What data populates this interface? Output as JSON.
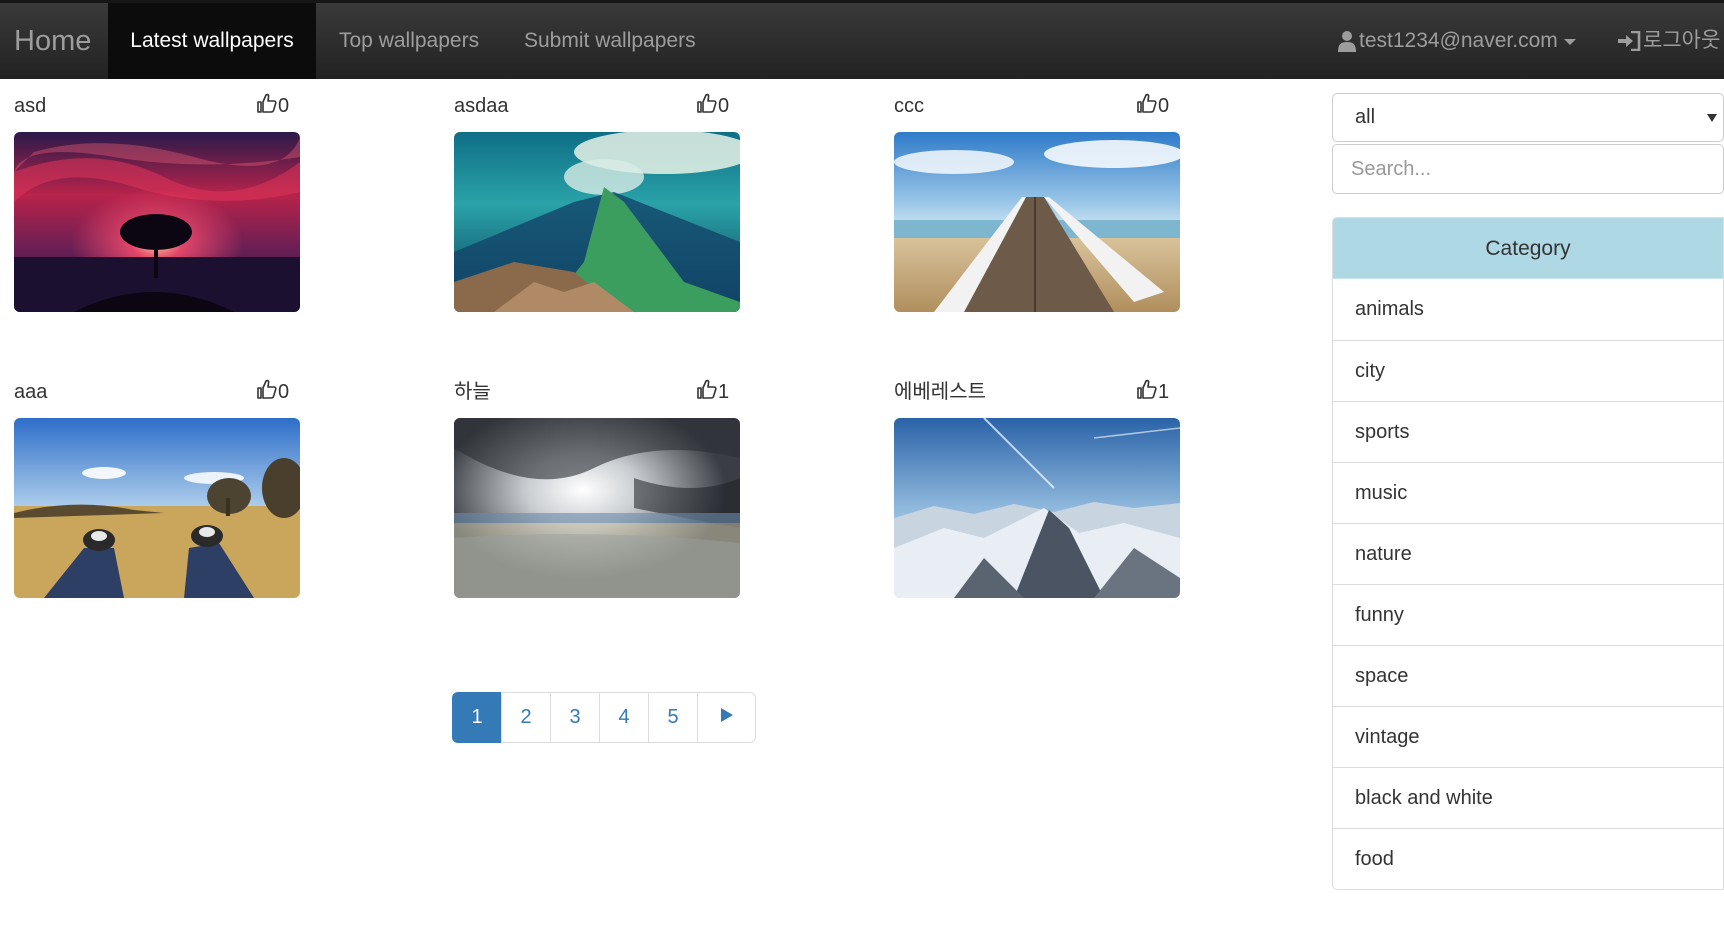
{
  "navbar": {
    "brand": "Home",
    "active_link": "Latest wallpapers",
    "links": [
      "Top wallpapers",
      "Submit wallpapers"
    ],
    "user_email": "test1234@naver.com",
    "logout_label": "로그아웃",
    "user_icon": "user-icon",
    "logout_icon": "sign-in-icon"
  },
  "wallpapers": [
    {
      "title": "asd",
      "likes": "0",
      "image": "red-sky-tree-sunset"
    },
    {
      "title": "asdaa",
      "likes": "0",
      "image": "mountain-ridge-teal"
    },
    {
      "title": "ccc",
      "likes": "0",
      "image": "wooden-pier-sea"
    },
    {
      "title": "aaa",
      "likes": "0",
      "image": "sneakers-field"
    },
    {
      "title": "하늘",
      "likes": "1",
      "image": "cloudy-sky"
    },
    {
      "title": "에베레스트",
      "likes": "1",
      "image": "snowy-mountains"
    }
  ],
  "pagination": {
    "pages": [
      "1",
      "2",
      "3",
      "4",
      "5"
    ],
    "active_page": "1",
    "next_icon": "play-icon"
  },
  "sidebar": {
    "filter_selected": "all",
    "search_placeholder": "Search...",
    "category_title": "Category",
    "categories": [
      "animals",
      "city",
      "sports",
      "music",
      "nature",
      "funny",
      "space",
      "vintage",
      "black and white",
      "food"
    ]
  },
  "colors": {
    "navbar_bg": "#222222",
    "active_nav_bg": "#0c0c0c",
    "accent_blue": "#337ab7",
    "category_header_bg": "#add8e4"
  }
}
